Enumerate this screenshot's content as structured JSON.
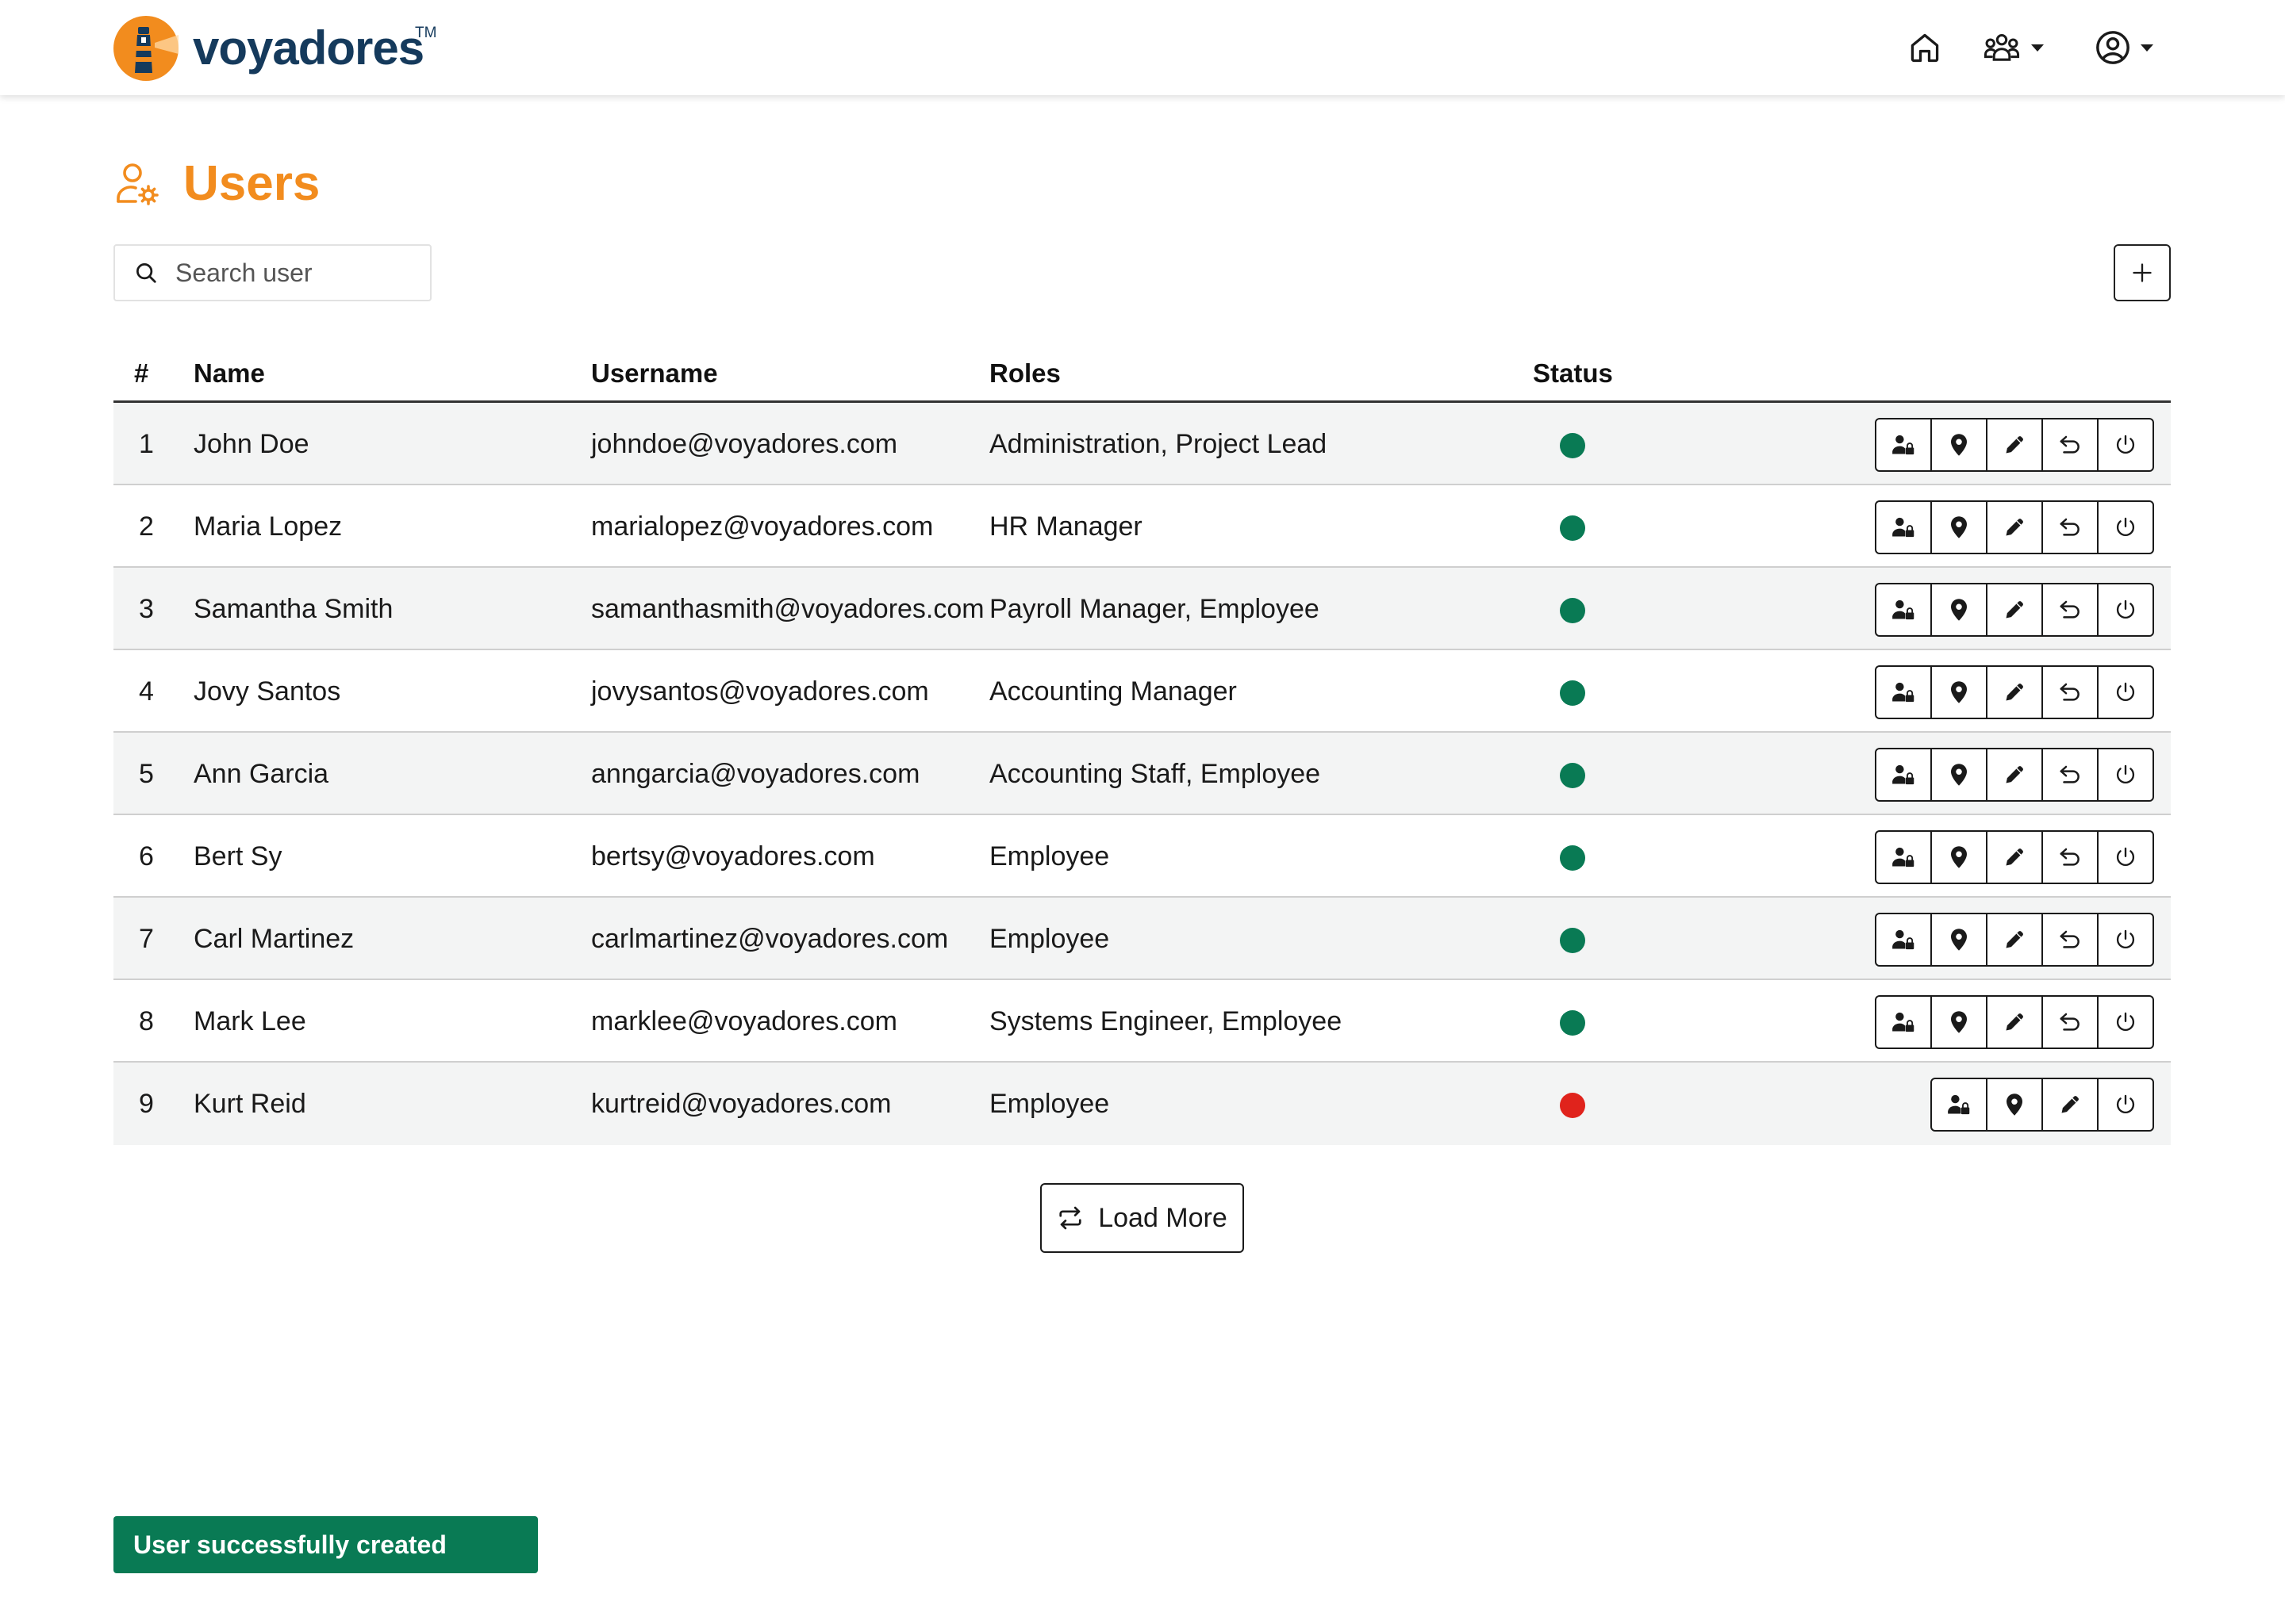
{
  "app": {
    "brand": "voyadores",
    "trademark": "TM"
  },
  "nav": {
    "home_icon": "home-icon",
    "team_icon": "team-icon",
    "account_icon": "user-circle-icon"
  },
  "page": {
    "title": "Users",
    "icon": "users-gear-icon"
  },
  "search": {
    "placeholder": "Search user",
    "value": ""
  },
  "add_button": {
    "icon": "plus-icon"
  },
  "table": {
    "columns": [
      "#",
      "Name",
      "Username",
      "Roles",
      "Status"
    ],
    "rows": [
      {
        "index": "1",
        "name": "John Doe",
        "username": "johndoe@voyadores.com",
        "roles": "Administration, Project Lead",
        "status": "active",
        "actions": [
          "assign-role",
          "location",
          "edit",
          "reset",
          "deactivate"
        ]
      },
      {
        "index": "2",
        "name": "Maria Lopez",
        "username": "marialopez@voyadores.com",
        "roles": "HR Manager",
        "status": "active",
        "actions": [
          "assign-role",
          "location",
          "edit",
          "reset",
          "deactivate"
        ]
      },
      {
        "index": "3",
        "name": "Samantha Smith",
        "username": "samanthasmith@voyadores.com",
        "roles": "Payroll Manager, Employee",
        "status": "active",
        "actions": [
          "assign-role",
          "location",
          "edit",
          "reset",
          "deactivate"
        ]
      },
      {
        "index": "4",
        "name": "Jovy Santos",
        "username": "jovysantos@voyadores.com",
        "roles": "Accounting Manager",
        "status": "active",
        "actions": [
          "assign-role",
          "location",
          "edit",
          "reset",
          "deactivate"
        ]
      },
      {
        "index": "5",
        "name": "Ann Garcia",
        "username": "anngarcia@voyadores.com",
        "roles": "Accounting Staff, Employee",
        "status": "active",
        "actions": [
          "assign-role",
          "location",
          "edit",
          "reset",
          "deactivate"
        ]
      },
      {
        "index": "6",
        "name": "Bert Sy",
        "username": "bertsy@voyadores.com",
        "roles": "Employee",
        "status": "active",
        "actions": [
          "assign-role",
          "location",
          "edit",
          "reset",
          "deactivate"
        ]
      },
      {
        "index": "7",
        "name": "Carl Martinez",
        "username": "carlmartinez@voyadores.com",
        "roles": "Employee",
        "status": "active",
        "actions": [
          "assign-role",
          "location",
          "edit",
          "reset",
          "deactivate"
        ]
      },
      {
        "index": "8",
        "name": "Mark Lee",
        "username": "marklee@voyadores.com",
        "roles": "Systems Engineer, Employee",
        "status": "active",
        "actions": [
          "assign-role",
          "location",
          "edit",
          "reset",
          "deactivate"
        ]
      },
      {
        "index": "9",
        "name": "Kurt Reid",
        "username": "kurtreid@voyadores.com",
        "roles": "Employee",
        "status": "inactive",
        "actions": [
          "assign-role",
          "location",
          "edit",
          "deactivate"
        ]
      }
    ]
  },
  "load_more": {
    "label": "Load More"
  },
  "toast": {
    "message": "User successfully created"
  },
  "colors": {
    "brand_orange": "#f28c1e",
    "brand_navy": "#153a5c",
    "status_active": "#097a54",
    "status_inactive": "#e0231c",
    "toast_bg": "#097a54"
  }
}
